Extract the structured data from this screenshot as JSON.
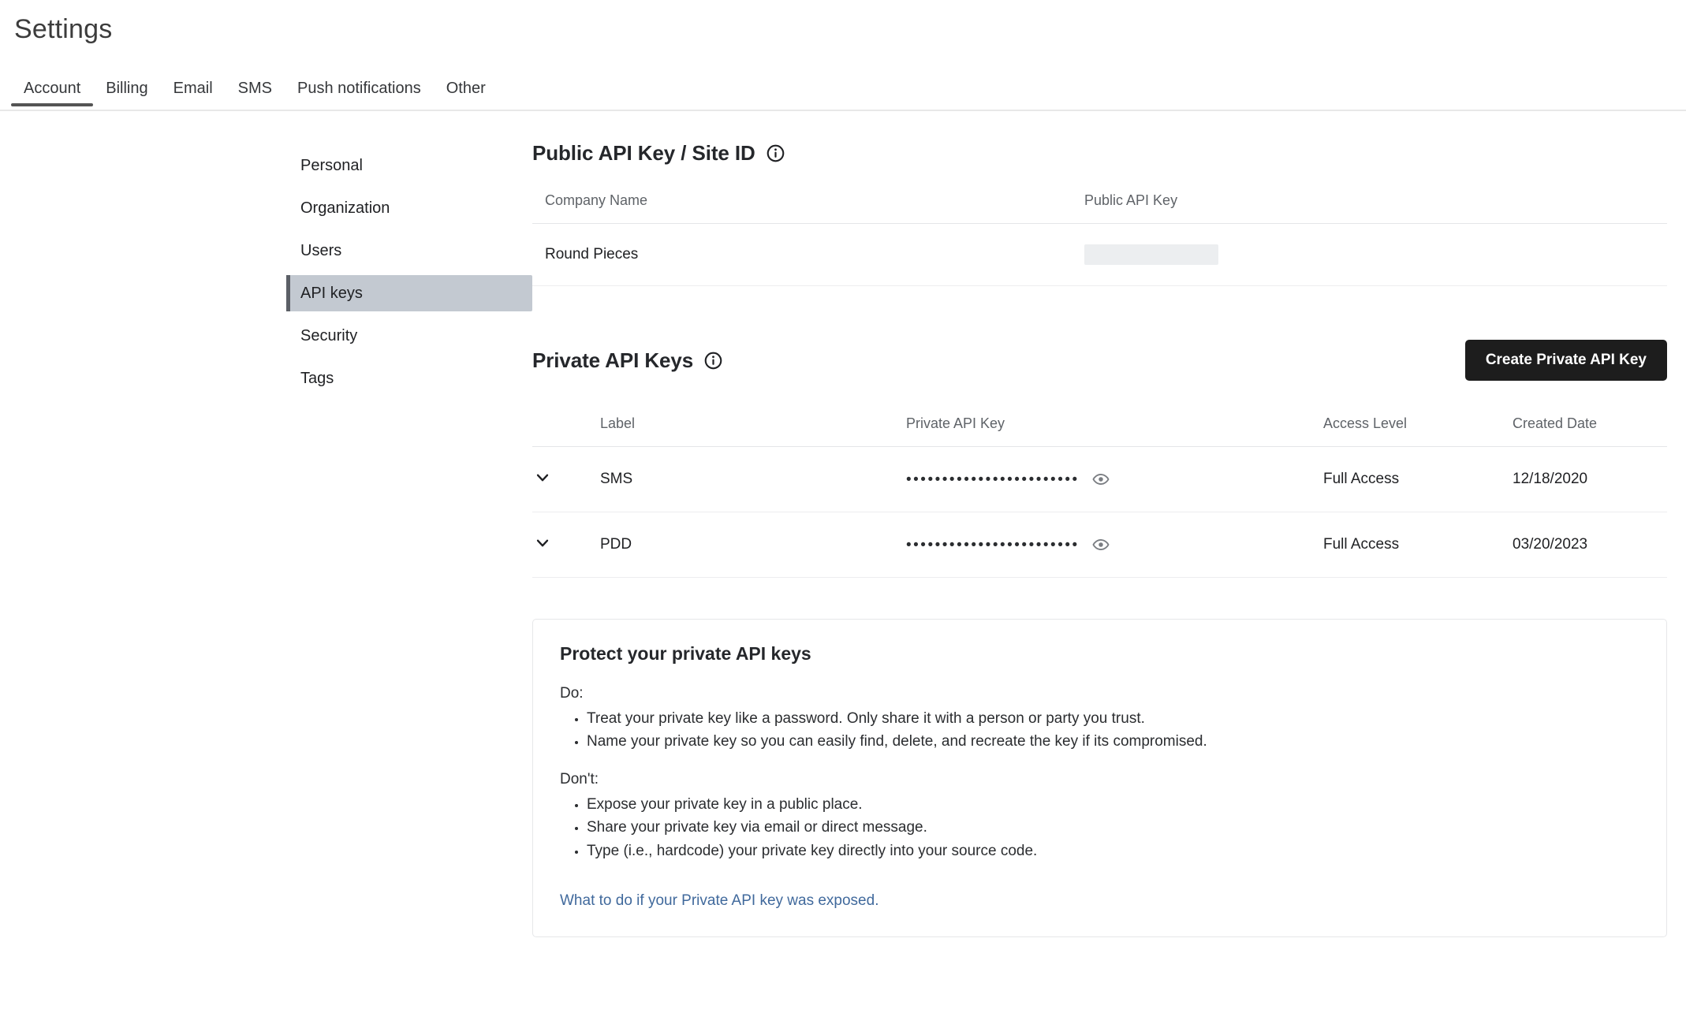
{
  "page": {
    "title": "Settings"
  },
  "tabs": [
    {
      "label": "Account",
      "active": true
    },
    {
      "label": "Billing",
      "active": false
    },
    {
      "label": "Email",
      "active": false
    },
    {
      "label": "SMS",
      "active": false
    },
    {
      "label": "Push notifications",
      "active": false
    },
    {
      "label": "Other",
      "active": false
    }
  ],
  "sidenav": {
    "items": [
      {
        "label": "Personal",
        "active": false
      },
      {
        "label": "Organization",
        "active": false
      },
      {
        "label": "Users",
        "active": false
      },
      {
        "label": "API keys",
        "active": true
      },
      {
        "label": "Security",
        "active": false
      },
      {
        "label": "Tags",
        "active": false
      }
    ]
  },
  "public_section": {
    "title": "Public API Key / Site ID",
    "columns": [
      "Company Name",
      "Public API Key"
    ],
    "rows": [
      {
        "company_name": "Round Pieces",
        "public_api_key": ""
      }
    ]
  },
  "private_section": {
    "title": "Private API Keys",
    "create_button": "Create Private API Key",
    "columns": [
      "Label",
      "Private API Key",
      "Access Level",
      "Created Date"
    ],
    "rows": [
      {
        "label": "SMS",
        "key_masked": "••••••••••••••••••••••••",
        "access_level": "Full Access",
        "created_date": "12/18/2020"
      },
      {
        "label": "PDD",
        "key_masked": "••••••••••••••••••••••••",
        "access_level": "Full Access",
        "created_date": "03/20/2023"
      }
    ]
  },
  "protect_panel": {
    "title": "Protect your private API keys",
    "do_label": "Do:",
    "do_items": [
      "Treat your private key like a password. Only share it with a person or party you trust.",
      "Name your private key so you can easily find, delete, and recreate the key if its compromised."
    ],
    "dont_label": "Don't:",
    "dont_items": [
      "Expose your private key in a public place.",
      "Share your private key via email or direct message.",
      "Type (i.e., hardcode) your private key directly into your source code."
    ],
    "link": "What to do if your Private API key was exposed."
  },
  "colors": {
    "accent_button": "#1d1d1d",
    "active_nav_bg": "#c3c9d1",
    "active_nav_bar": "#5b5f66",
    "active_tab_underline": "#545454",
    "link": "#40699c",
    "redaction": "#eceef0"
  }
}
